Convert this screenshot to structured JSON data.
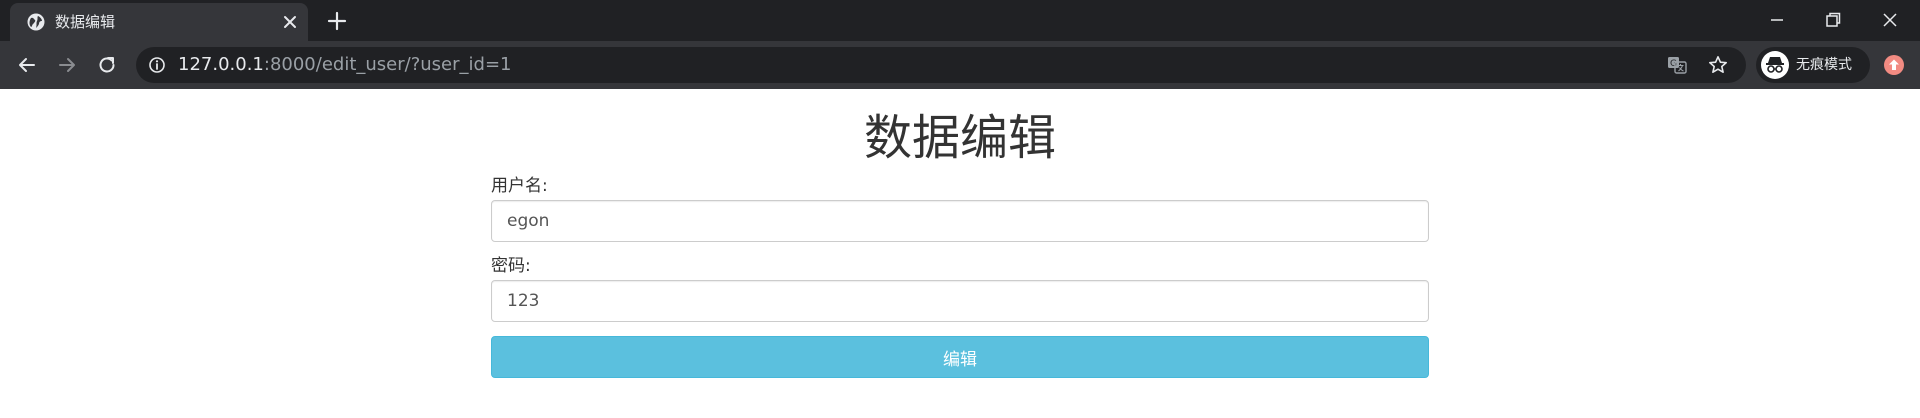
{
  "browser": {
    "tab": {
      "title": "数据编辑",
      "favicon": "globe-icon",
      "close_icon": "close-icon"
    },
    "new_tab_icon": "plus-icon",
    "window_controls": [
      "minimize-icon",
      "restore-icon",
      "close-icon"
    ],
    "nav": {
      "back_icon": "arrow-left-icon",
      "forward_icon": "arrow-right-icon",
      "reload_icon": "reload-icon"
    },
    "address_bar": {
      "site_info_icon": "info-icon",
      "url_host": "127.0.0.1",
      "url_rest": ":8000/edit_user/?user_id=1",
      "translate_icon": "translate-icon",
      "bookmark_icon": "star-icon"
    },
    "profile": {
      "label": "无痕模式",
      "icon": "incognito-icon"
    },
    "update_icon": "update-arrow-icon"
  },
  "form": {
    "title": "数据编辑",
    "username": {
      "label": "用户名:",
      "value": "egon"
    },
    "password": {
      "label": "密码:",
      "value": "123"
    },
    "submit_label": "编辑"
  },
  "colors": {
    "chrome_dark": "#202124",
    "chrome_tab": "#35363a",
    "button_info": "#5bc0de",
    "update_badge": "#f28b82"
  }
}
